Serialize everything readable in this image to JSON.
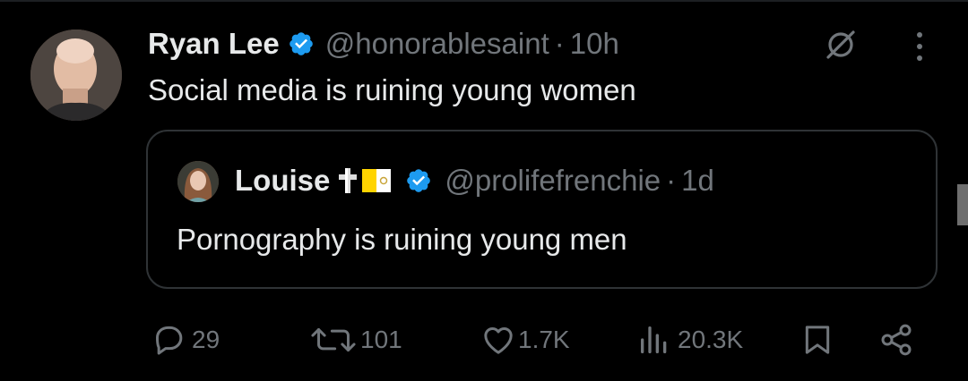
{
  "tweet": {
    "author_name": "Ryan Lee",
    "author_handle": "@honorablesaint",
    "separator": "·",
    "time": "10h",
    "text": "Social media is ruining young women",
    "avatar_icon": "user-avatar"
  },
  "quote": {
    "author_name": "Louise",
    "author_handle": "@prolifefrenchie",
    "separator": "·",
    "time": "1d",
    "text": "Pornography is ruining young men",
    "emoji": [
      "latin-cross-icon",
      "vatican-flag-icon"
    ]
  },
  "actions": {
    "replies": "29",
    "reposts": "101",
    "likes": "1.7K",
    "views": "20.3K"
  },
  "colors": {
    "background": "#000000",
    "text": "#e7e9ea",
    "secondary": "#71767b",
    "verified": "#1d9bf0",
    "border": "#2f3336"
  }
}
